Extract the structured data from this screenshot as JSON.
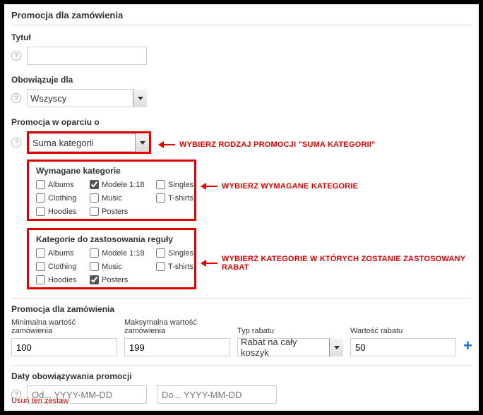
{
  "hdr": {
    "title": "Promocja dla zamówienia"
  },
  "title_field": {
    "label": "Tytuł",
    "value": ""
  },
  "applies": {
    "label": "Obowiązuje dla",
    "value": "Wszyscy"
  },
  "based": {
    "label": "Promocja w oparciu o",
    "value": "Suma kategorii"
  },
  "req_cats": {
    "title": "Wymagane kategorie",
    "items": [
      {
        "label": "Albums",
        "checked": false
      },
      {
        "label": "Modele 1:18",
        "checked": true
      },
      {
        "label": "Singles",
        "checked": false
      },
      {
        "label": "Clothing",
        "checked": false
      },
      {
        "label": "Music",
        "checked": false
      },
      {
        "label": "T-shirts",
        "checked": false
      },
      {
        "label": "Hoodies",
        "checked": false
      },
      {
        "label": "Posters",
        "checked": false
      }
    ]
  },
  "apply_cats": {
    "title": "Kategorie do zastosowania reguły",
    "items": [
      {
        "label": "Albums",
        "checked": false
      },
      {
        "label": "Modele 1:18",
        "checked": false
      },
      {
        "label": "Singles",
        "checked": false
      },
      {
        "label": "Clothing",
        "checked": false
      },
      {
        "label": "Music",
        "checked": false
      },
      {
        "label": "T-shirts",
        "checked": false
      },
      {
        "label": "Hoodies",
        "checked": false
      },
      {
        "label": "Posters",
        "checked": true
      }
    ]
  },
  "callouts": {
    "c1": "WYBIERZ RODZAJ PROMOCJI \"SUMA KATEGORII\"",
    "c2": "WYBIERZ WYMAGANE KATEGORIE",
    "c3": "WYBIERZ KATEGORIE W KTÓRYCH ZOSTANIE ZASTOSOWANY RABAT"
  },
  "order_promo": {
    "head": "Promocja dla zamówienia",
    "min_label": "Minimalna wartość zamówienia",
    "min_value": "100",
    "max_label": "Maksymalna wartość zamówienia",
    "max_value": "199",
    "type_label": "Typ rabatu",
    "type_value": "Rabat na cały koszyk",
    "amount_label": "Wartość rabatu",
    "amount_value": "50"
  },
  "dates": {
    "head": "Daty obowiązywania promocji",
    "from_ph": "Od... YYYY-MM-DD",
    "to_ph": "Do... YYYY-MM-DD"
  },
  "delete_label": "Usuń ten zestaw"
}
